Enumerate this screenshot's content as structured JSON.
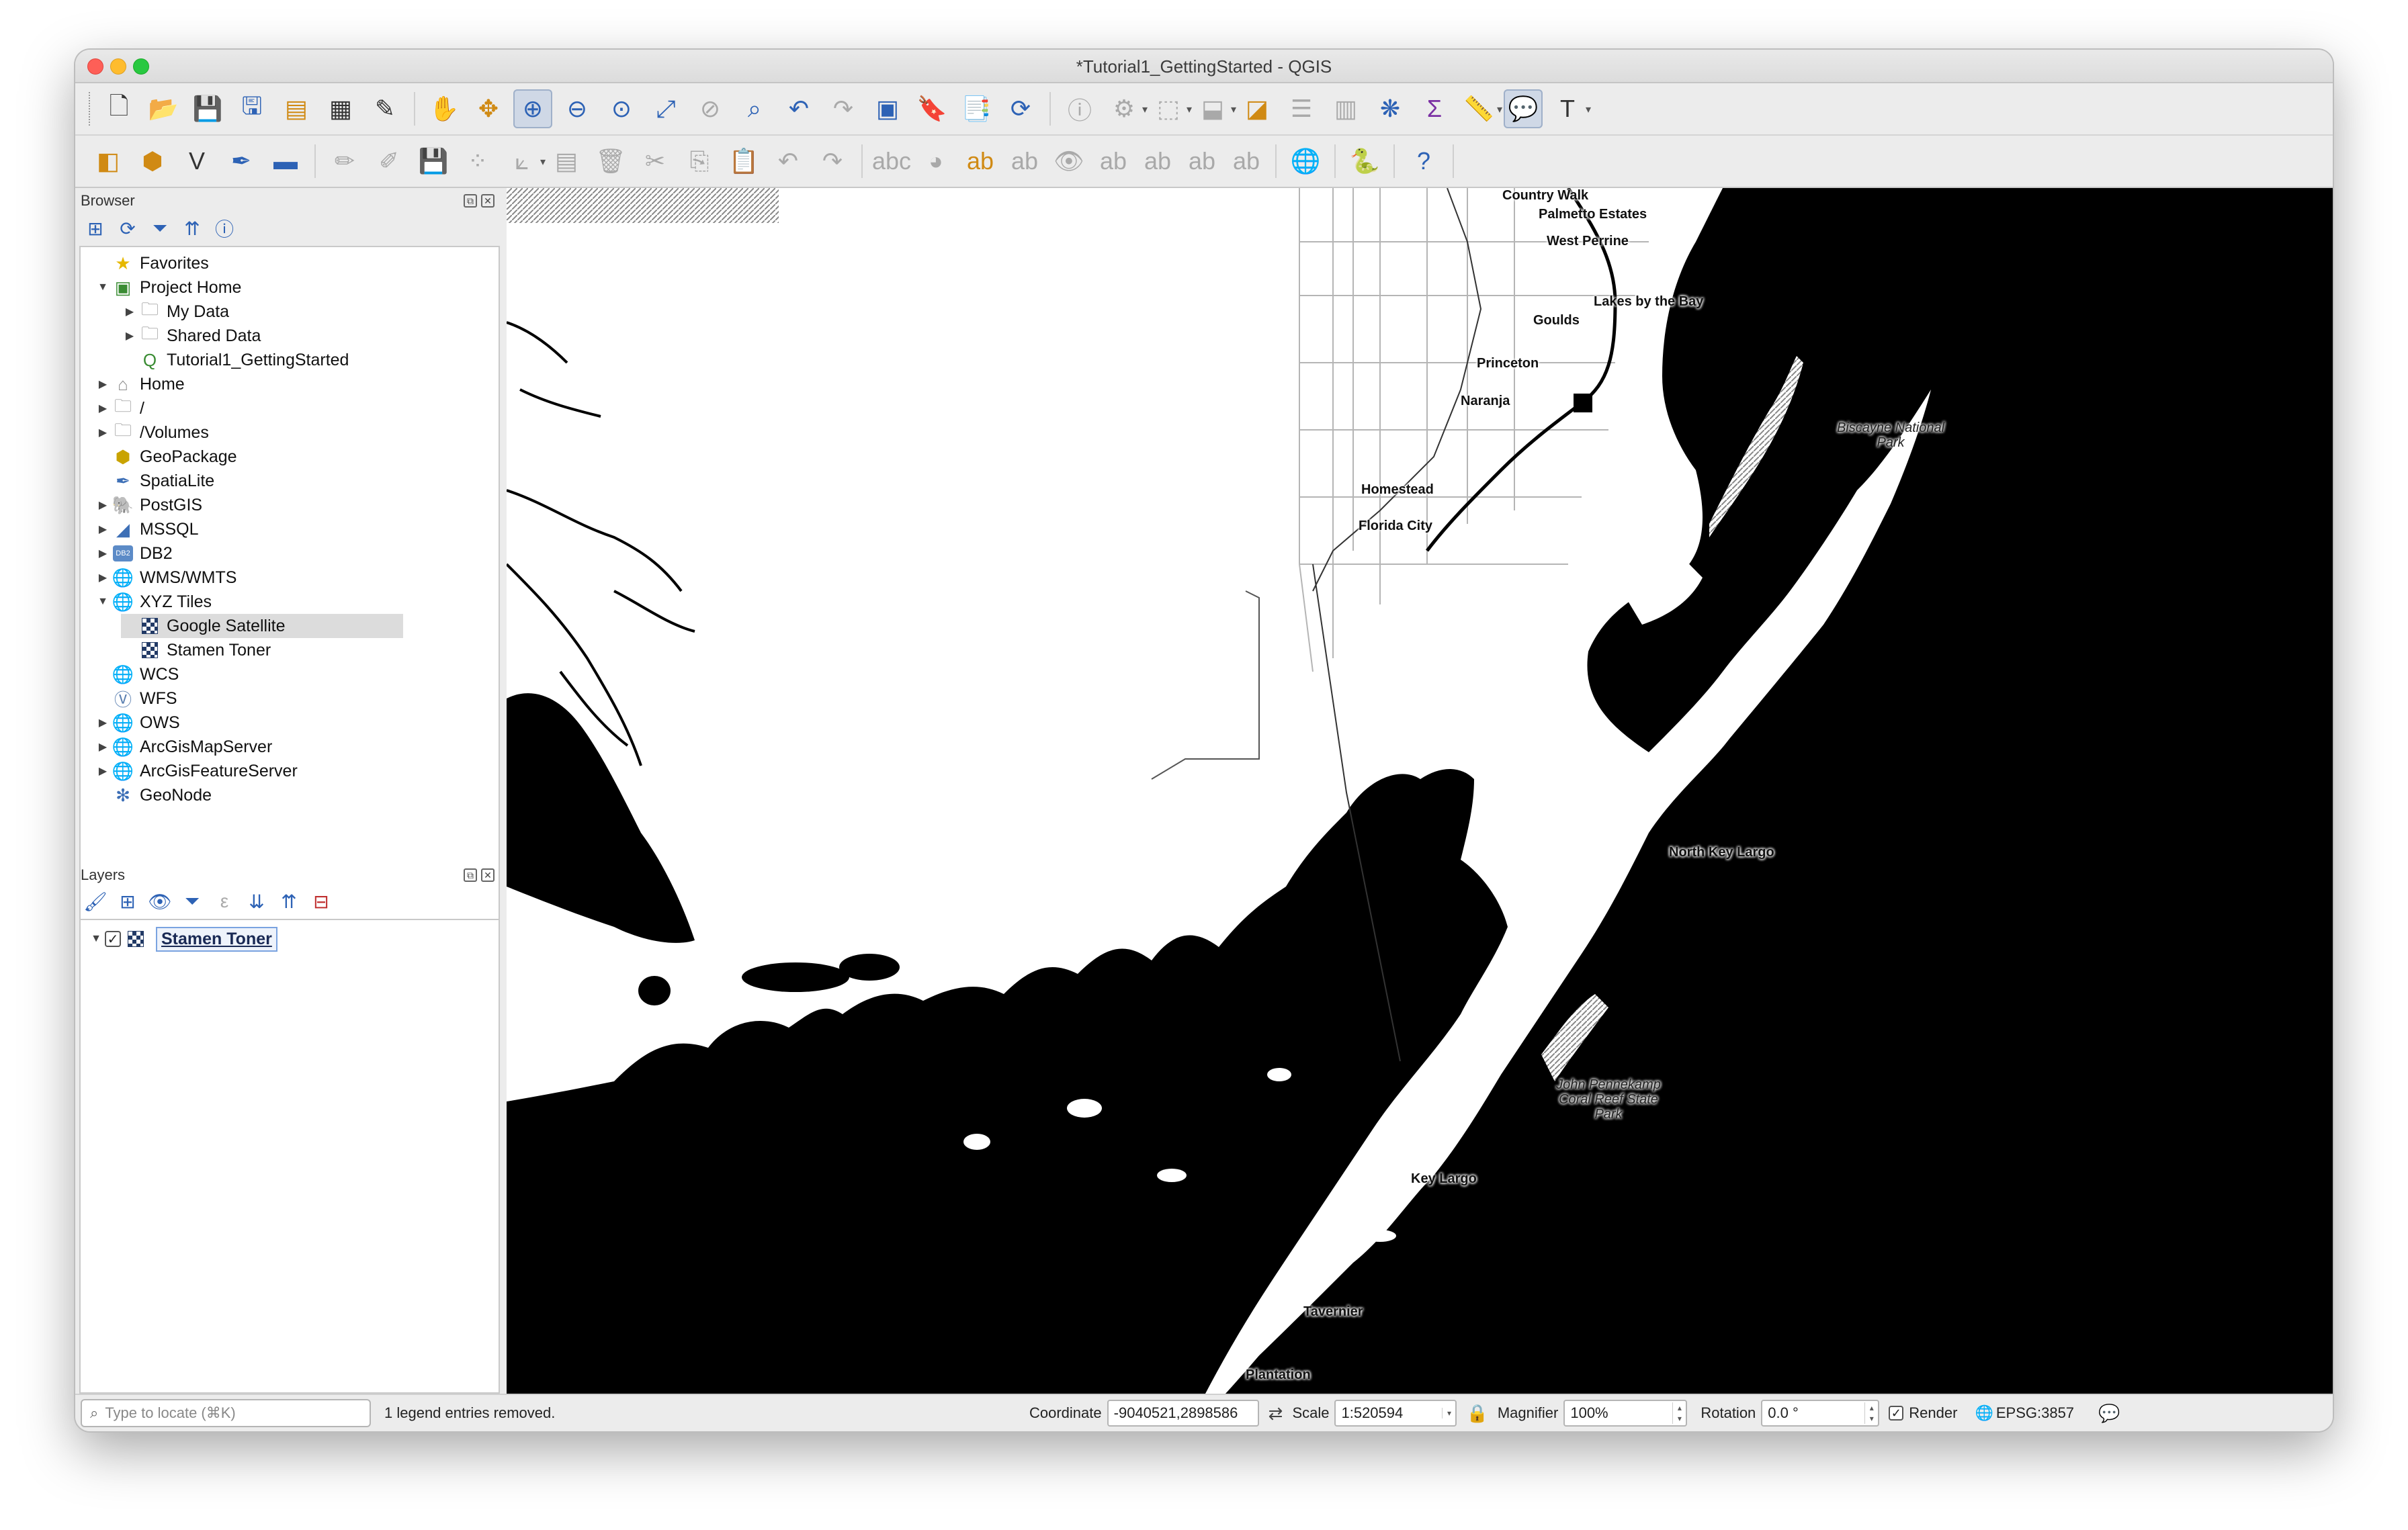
{
  "window": {
    "title": "*Tutorial1_GettingStarted - QGIS"
  },
  "browser": {
    "title": "Browser",
    "items": [
      {
        "label": "Favorites",
        "icon": "star-icon"
      },
      {
        "label": "Project Home",
        "icon": "project-home-icon",
        "expanded": true
      },
      {
        "label": "My Data",
        "icon": "folder-icon"
      },
      {
        "label": "Shared Data",
        "icon": "folder-icon"
      },
      {
        "label": "Tutorial1_GettingStarted",
        "icon": "qgis-project-icon"
      },
      {
        "label": "Home",
        "icon": "home-folder-icon"
      },
      {
        "label": "/",
        "icon": "folder-icon"
      },
      {
        "label": "/Volumes",
        "icon": "folder-icon"
      },
      {
        "label": "GeoPackage",
        "icon": "geopackage-icon"
      },
      {
        "label": "SpatiaLite",
        "icon": "spatialite-icon"
      },
      {
        "label": "PostGIS",
        "icon": "postgis-icon"
      },
      {
        "label": "MSSQL",
        "icon": "mssql-icon"
      },
      {
        "label": "DB2",
        "icon": "db2-icon"
      },
      {
        "label": "WMS/WMTS",
        "icon": "globe-icon"
      },
      {
        "label": "XYZ Tiles",
        "icon": "globe-icon",
        "expanded": true
      },
      {
        "label": "Google Satellite",
        "icon": "tiles-icon",
        "selected": true
      },
      {
        "label": "Stamen Toner",
        "icon": "tiles-icon"
      },
      {
        "label": "WCS",
        "icon": "globe-icon"
      },
      {
        "label": "WFS",
        "icon": "wfs-icon"
      },
      {
        "label": "OWS",
        "icon": "globe-icon"
      },
      {
        "label": "ArcGisMapServer",
        "icon": "globe-icon"
      },
      {
        "label": "ArcGisFeatureServer",
        "icon": "globe-icon"
      },
      {
        "label": "GeoNode",
        "icon": "geonode-icon"
      }
    ]
  },
  "layers": {
    "title": "Layers",
    "items": [
      {
        "label": "Stamen Toner",
        "checked": true
      }
    ]
  },
  "map": {
    "labels": [
      "Country Walk",
      "Palmetto Estates",
      "West Perrine",
      "Lakes by the Bay",
      "Goulds",
      "Princeton",
      "Naranja",
      "Homestead",
      "Florida City",
      "Biscayne National Park",
      "North Key Largo",
      "John Pennekamp Coral Reef State Park",
      "Key Largo",
      "Tavernier",
      "Plantation"
    ]
  },
  "status": {
    "locator_placeholder": "Type to locate (⌘K)",
    "message": "1 legend entries removed.",
    "coordinate_label": "Coordinate",
    "coordinate_value": "-9040521,2898586",
    "scale_label": "Scale",
    "scale_value": "1:520594",
    "magnifier_label": "Magnifier",
    "magnifier_value": "100%",
    "rotation_label": "Rotation",
    "rotation_value": "0.0 °",
    "render_label": "Render",
    "crs": "EPSG:3857"
  }
}
